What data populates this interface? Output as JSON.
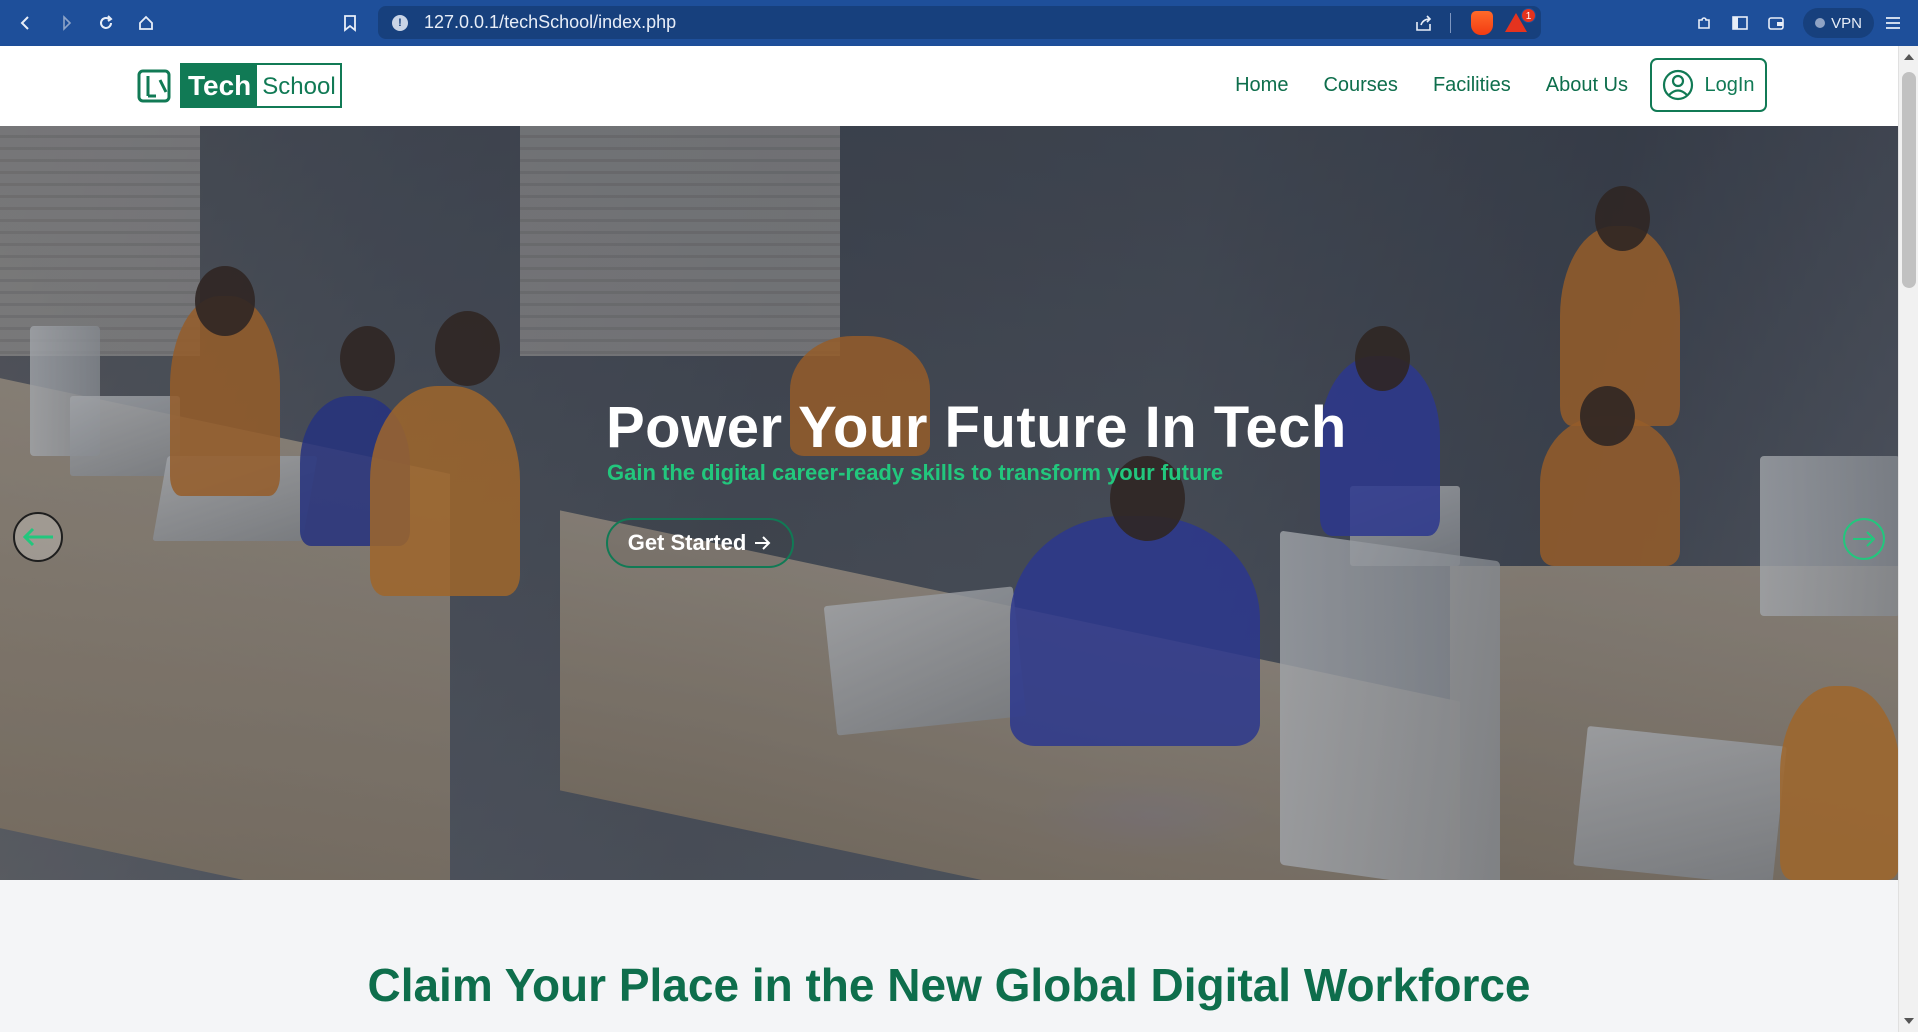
{
  "browser": {
    "url": "127.0.0.1/techSchool/index.php",
    "vpn_label": "VPN",
    "notification_count": "1",
    "icons": [
      "back-icon",
      "forward-icon",
      "reload-icon",
      "home-icon",
      "bookmark-icon",
      "info-icon",
      "share-icon",
      "brave-shields-icon",
      "brave-rewards-icon",
      "extensions-icon",
      "sidebar-icon",
      "wallet-icon",
      "menu-icon"
    ]
  },
  "header": {
    "logo_tech": "Tech",
    "logo_school": "School",
    "nav": [
      {
        "label": "Home"
      },
      {
        "label": "Courses"
      },
      {
        "label": "Facilities"
      },
      {
        "label": "About Us"
      }
    ],
    "login_label": "LogIn"
  },
  "hero": {
    "title": "Power Your Future In Tech",
    "subtitle": "Gain the digital career-ready skills to transform your future",
    "cta_label": "Get Started"
  },
  "section": {
    "title": "Claim Your Place in the New Global Digital Workforce"
  },
  "colors": {
    "chrome": "#1e4f9a",
    "brand_green": "#117a55",
    "accent_green": "#22c77d"
  }
}
